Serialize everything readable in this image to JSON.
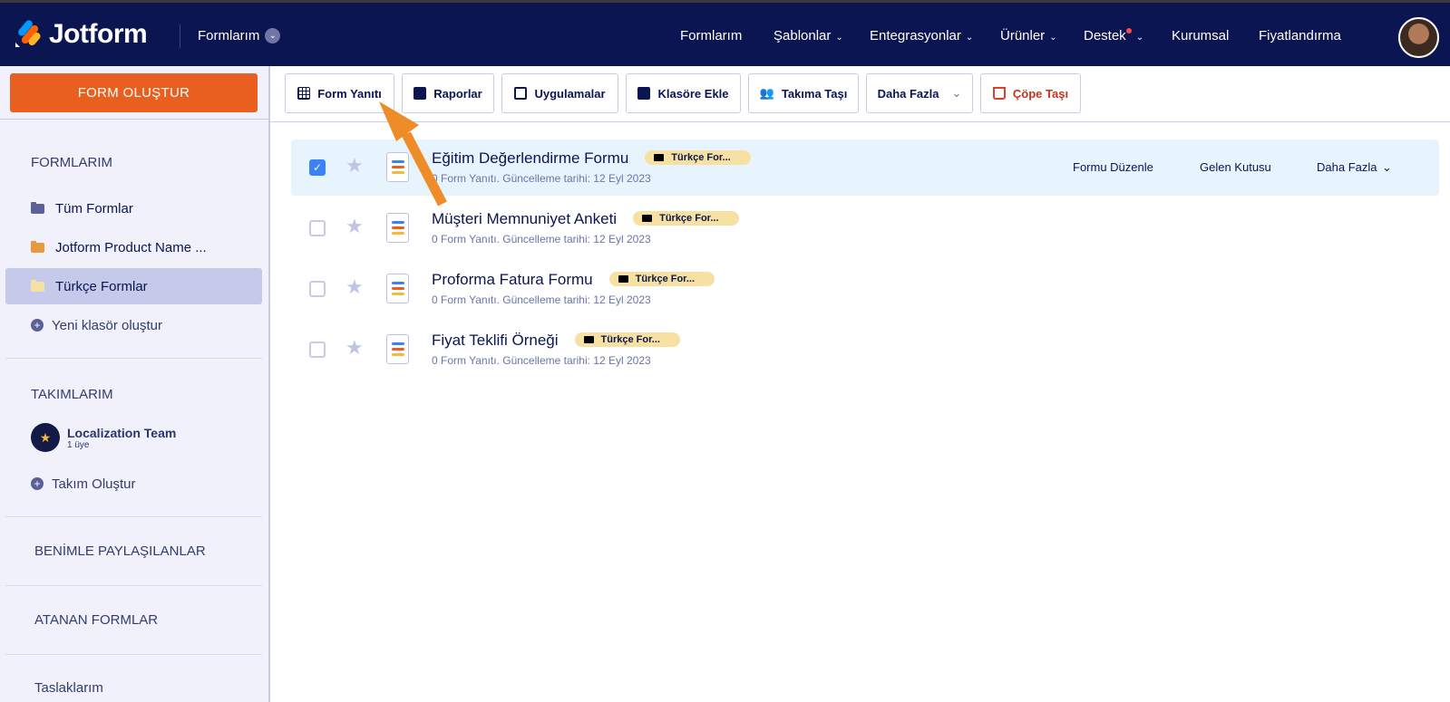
{
  "header": {
    "logo": "Jotform",
    "breadcrumb": "Formlarım",
    "nav": [
      {
        "label": "Formlarım",
        "chevron": false
      },
      {
        "label": "Şablonlar",
        "chevron": true
      },
      {
        "label": "Entegrasyonlar",
        "chevron": true
      },
      {
        "label": "Ürünler",
        "chevron": true
      },
      {
        "label": "Destek",
        "chevron": true,
        "dot": true
      },
      {
        "label": "Kurumsal",
        "chevron": false
      },
      {
        "label": "Fiyatlandırma",
        "chevron": false
      }
    ]
  },
  "sidebar": {
    "create_label": "FORM OLUŞTUR",
    "forms_heading": "FORMLARIM",
    "folders": [
      {
        "label": "Tüm Formlar",
        "color": "#5b6198"
      },
      {
        "label": "Jotform Product Name ...",
        "color": "#e69a3f"
      },
      {
        "label": "Türkçe Formlar",
        "color": "#f6e1a2",
        "active": true
      }
    ],
    "new_folder": "Yeni klasör oluştur",
    "teams_heading": "TAKIMLARIM",
    "team": {
      "name": "Localization Team",
      "members": "1 üye"
    },
    "create_team": "Takım Oluştur",
    "shared": "BENİMLE PAYLAŞILANLAR",
    "assigned": "ATANAN FORMLAR",
    "drafts": "Taslaklarım"
  },
  "toolbar": {
    "responses": "Form Yanıtı",
    "reports": "Raporlar",
    "apps": "Uygulamalar",
    "add_folder": "Klasöre Ekle",
    "move_team": "Takıma Taşı",
    "more": "Daha Fazla",
    "trash": "Çöpe Taşı"
  },
  "forms": [
    {
      "title": "Eğitim Değerlendirme Formu",
      "tag": "Türkçe For...",
      "sub": "0 Form Yanıtı. Güncelleme tarihi: 12 Eyl 2023",
      "checked": true
    },
    {
      "title": "Müşteri Memnuniyet Anketi",
      "tag": "Türkçe For...",
      "sub": "0 Form Yanıtı. Güncelleme tarihi: 12 Eyl 2023",
      "checked": false
    },
    {
      "title": "Proforma Fatura Formu",
      "tag": "Türkçe For...",
      "sub": "0 Form Yanıtı. Güncelleme tarihi: 12 Eyl 2023",
      "checked": false
    },
    {
      "title": "Fiyat Teklifi Örneği",
      "tag": "Türkçe For...",
      "sub": "0 Form Yanıtı. Güncelleme tarihi: 12 Eyl 2023",
      "checked": false
    }
  ],
  "row_actions": {
    "edit": "Formu Düzenle",
    "inbox": "Gelen Kutusu",
    "more": "Daha Fazla"
  },
  "colors": {
    "navy": "#0a1551",
    "orange": "#e95f20",
    "arrow": "#ef8c2a"
  }
}
